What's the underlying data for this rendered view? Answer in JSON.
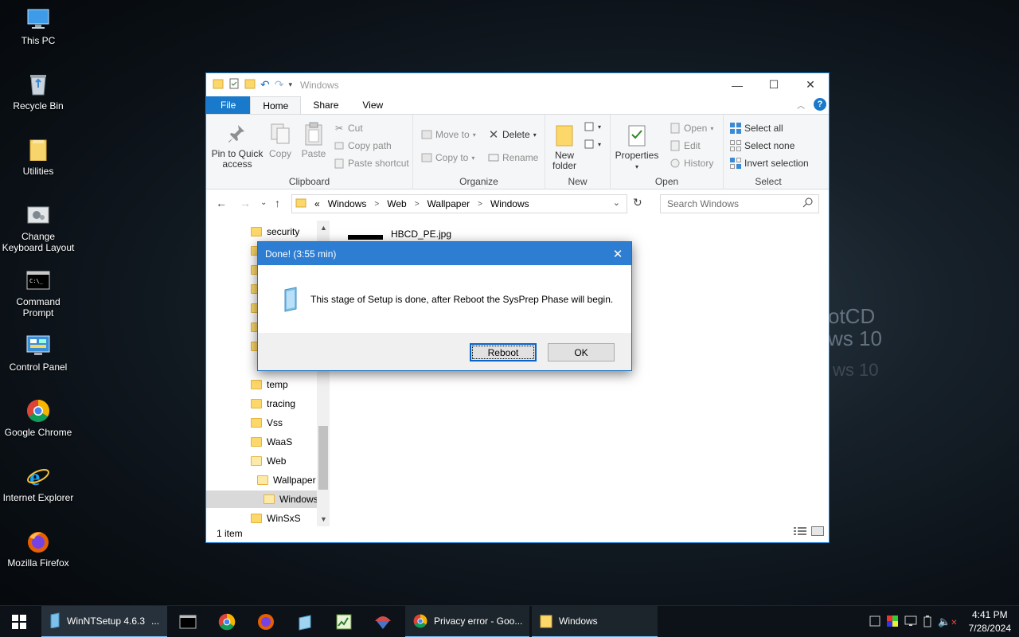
{
  "desktop": {
    "icons": [
      {
        "label": "This PC",
        "icon": "computer-icon"
      },
      {
        "label": "Recycle Bin",
        "icon": "recycle-bin-icon"
      },
      {
        "label": "Utilities",
        "icon": "folder-icon"
      },
      {
        "label": "Change Keyboard Layout",
        "icon": "keyboard-settings-icon"
      },
      {
        "label": "Command Prompt",
        "icon": "cmd-icon"
      },
      {
        "label": "Control Panel",
        "icon": "control-panel-icon"
      },
      {
        "label": "Google Chrome",
        "icon": "chrome-icon"
      },
      {
        "label": "Internet Explorer",
        "icon": "ie-icon"
      },
      {
        "label": "Mozilla Firefox",
        "icon": "firefox-icon"
      }
    ],
    "wallpaper_text": [
      "otCD",
      "ws 10",
      "ws 10"
    ]
  },
  "explorer": {
    "title": "Windows",
    "tabs": {
      "file": "File",
      "home": "Home",
      "share": "Share",
      "view": "View"
    },
    "ribbon": {
      "clipboard": {
        "label": "Clipboard",
        "pin": "Pin to Quick access",
        "copy": "Copy",
        "paste": "Paste",
        "cut": "Cut",
        "copy_path": "Copy path",
        "paste_shortcut": "Paste shortcut"
      },
      "organize": {
        "label": "Organize",
        "move_to": "Move to",
        "copy_to": "Copy to",
        "delete": "Delete",
        "rename": "Rename"
      },
      "new": {
        "label": "New",
        "new_folder": "New folder"
      },
      "open": {
        "label": "Open",
        "properties": "Properties",
        "open": "Open",
        "edit": "Edit",
        "history": "History"
      },
      "select": {
        "label": "Select",
        "select_all": "Select all",
        "select_none": "Select none",
        "invert": "Invert selection"
      }
    },
    "address": {
      "prefix": "«",
      "crumbs": [
        "Windows",
        "Web",
        "Wallpaper",
        "Windows"
      ]
    },
    "search_placeholder": "Search Windows",
    "tree": [
      {
        "label": "security",
        "indent": 0
      },
      {
        "label": "temp",
        "indent": 0
      },
      {
        "label": "tracing",
        "indent": 0
      },
      {
        "label": "Vss",
        "indent": 0
      },
      {
        "label": "WaaS",
        "indent": 0
      },
      {
        "label": "Web",
        "indent": 0
      },
      {
        "label": "Wallpaper",
        "indent": 1
      },
      {
        "label": "Windows",
        "indent": 2,
        "selected": true
      },
      {
        "label": "WinSxS",
        "indent": 0
      }
    ],
    "file": {
      "name": "HBCD_PE.jpg"
    },
    "status": "1 item"
  },
  "dialog": {
    "title": "Done! (3:55 min)",
    "message": "This stage of Setup is done, after Reboot the SysPrep Phase will begin.",
    "reboot": "Reboot",
    "ok": "OK"
  },
  "taskbar": {
    "winntsetup": "WinNTSetup 4.6.3",
    "winntsetup_more": "...",
    "chrome_window": "Privacy error - Goo...",
    "explorer_window": "Windows",
    "time": "4:41 PM",
    "date": "7/28/2024"
  },
  "colors": {
    "accent": "#1979ca",
    "dialog_title": "#2d7dd2",
    "folder": "#fcd76a"
  }
}
